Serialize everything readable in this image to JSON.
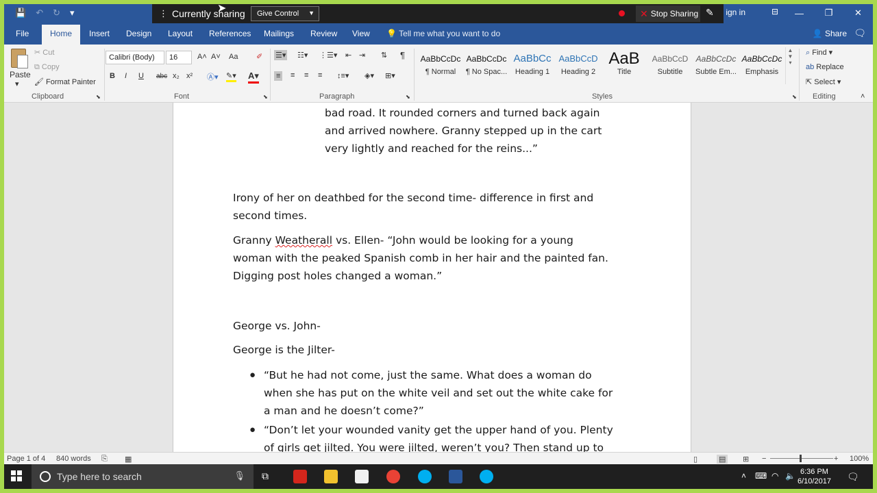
{
  "titlebar": {
    "save_icon": "💾",
    "undo_icon": "↶",
    "redo_icon": "↻",
    "qat_more": "▾",
    "signin": "ign in",
    "controls": [
      "—",
      "❐",
      "✕"
    ]
  },
  "sharing": {
    "status": "Currently sharing",
    "give_control": "Give Control",
    "stop": "Stop Sharing"
  },
  "tabs": [
    "File",
    "Home",
    "Insert",
    "Design",
    "Layout",
    "References",
    "Mailings",
    "Review",
    "View"
  ],
  "tell_me": "Tell me what you want to do",
  "share": "Share",
  "clipboard": {
    "paste": "Paste",
    "cut": "Cut",
    "copy": "Copy",
    "format_painter": "Format Painter",
    "label": "Clipboard"
  },
  "font": {
    "name": "Calibri (Body)",
    "size": "16",
    "label": "Font",
    "bold": "B",
    "italic": "I",
    "underline": "U",
    "strike": "abc",
    "sub": "x₂",
    "sup": "x²",
    "grow": "A˄",
    "shrink": "A˅",
    "case": "Aa"
  },
  "paragraph": {
    "label": "Paragraph"
  },
  "styles": {
    "label": "Styles",
    "items": [
      {
        "preview": "AaBbCcDc",
        "name": "¶ Normal"
      },
      {
        "preview": "AaBbCcDc",
        "name": "¶ No Spac..."
      },
      {
        "preview": "AaBbCc",
        "name": "Heading 1"
      },
      {
        "preview": "AaBbCcD",
        "name": "Heading 2"
      },
      {
        "preview": "AaB",
        "name": "Title"
      },
      {
        "preview": "AaBbCcD",
        "name": "Subtitle"
      },
      {
        "preview": "AaBbCcDc",
        "name": "Subtle Em..."
      },
      {
        "preview": "AaBbCcDc",
        "name": "Emphasis"
      }
    ]
  },
  "editing": {
    "find": "Find",
    "replace": "Replace",
    "select": "Select",
    "label": "Editing"
  },
  "document": {
    "quote_lines": [
      "bad road. It rounded corners and turned back again",
      "and arrived nowhere. Granny stepped up in the cart",
      "very lightly and reached for the reins...”"
    ],
    "para1_lines": [
      "Irony of her on deathbed for the second time- difference in first and",
      "second times."
    ],
    "para2_prefix": "Granny ",
    "para2_misspelled": "Weatherall",
    "para2_rest": " vs. Ellen- “John would be looking for a young",
    "para2_lines": [
      "woman with the peaked Spanish comb in her hair and the painted fan.",
      "Digging post holes changed a woman.”"
    ],
    "heading1": "George vs. John-",
    "heading2": "George is the Jilter-",
    "bullet1_lines": [
      "“But he had not come, just the same. What does a woman do",
      "when she has put on the white veil and set out the white cake for",
      "a man and he doesn’t come?”"
    ],
    "bullet2_lines": [
      "“Don’t let your wounded vanity get the upper hand of you. Plenty",
      "of girls get jilted. You were jilted, weren’t you? Then stand up to"
    ]
  },
  "status": {
    "page": "Page 1 of 4",
    "words": "840 words",
    "zoom": "100%",
    "zoom_minus": "−",
    "zoom_plus": "+"
  },
  "taskbar": {
    "search_placeholder": "Type here to search",
    "time": "6:36 PM",
    "date": "6/10/2017"
  }
}
